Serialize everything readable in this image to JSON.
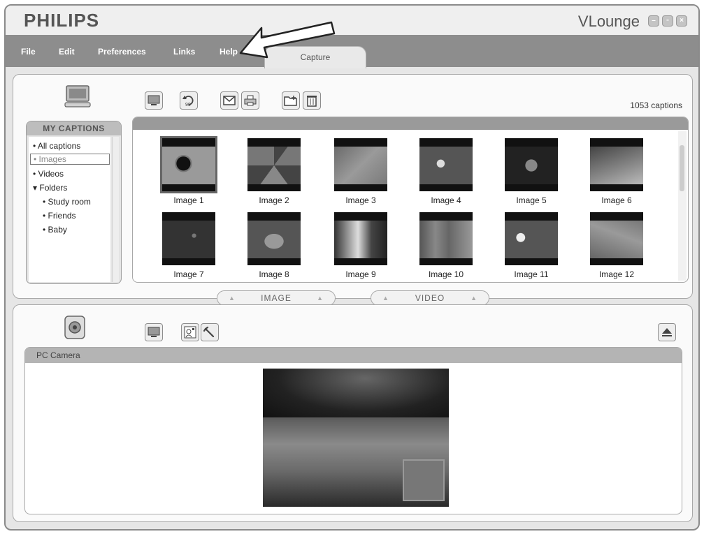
{
  "window": {
    "brand": "PHILIPS",
    "app_title": "VLounge",
    "controls": [
      "minimize-icon",
      "restore-icon",
      "close-icon"
    ]
  },
  "menu": {
    "items": [
      "File",
      "Edit",
      "Preferences",
      "Links",
      "Help"
    ]
  },
  "tabs": {
    "capture": "Capture"
  },
  "image_toolbar": {
    "icons": [
      "monitor-icon",
      "rotate-90-icon",
      "email-icon",
      "print-icon",
      "new-folder-icon",
      "delete-icon"
    ],
    "rotate_label": "90"
  },
  "captions_count": "1053 captions",
  "sidebar": {
    "title": "MY CAPTIONS",
    "items": [
      {
        "label": "All captions",
        "bullet": "•"
      },
      {
        "label": "Images",
        "bullet": "•"
      },
      {
        "label": "Videos",
        "bullet": "•"
      },
      {
        "label": "Folders",
        "bullet": "▾"
      },
      {
        "label": "Study room",
        "bullet": "•"
      },
      {
        "label": "Friends",
        "bullet": "•"
      },
      {
        "label": "Baby",
        "bullet": "•"
      }
    ]
  },
  "gallery": {
    "items": [
      {
        "label": "Image 1"
      },
      {
        "label": "Image 2"
      },
      {
        "label": "Image 3"
      },
      {
        "label": "Image 4"
      },
      {
        "label": "Image 5"
      },
      {
        "label": "Image 6"
      },
      {
        "label": "Image 7"
      },
      {
        "label": "Image 8"
      },
      {
        "label": "Image 9"
      },
      {
        "label": "Image 10"
      },
      {
        "label": "Image 11"
      },
      {
        "label": "Image 12"
      }
    ]
  },
  "mode_tabs": {
    "image": "IMAGE",
    "video": "VIDEO"
  },
  "camera_toolbar": {
    "icons": [
      "monitor-icon",
      "image-settings-icon",
      "wrench-icon",
      "eject-icon"
    ]
  },
  "camera": {
    "title": "PC Camera"
  },
  "colors": {
    "menubar": "#8d8d8d",
    "panel": "#fafafa",
    "accent_gray": "#9a9a9a"
  }
}
